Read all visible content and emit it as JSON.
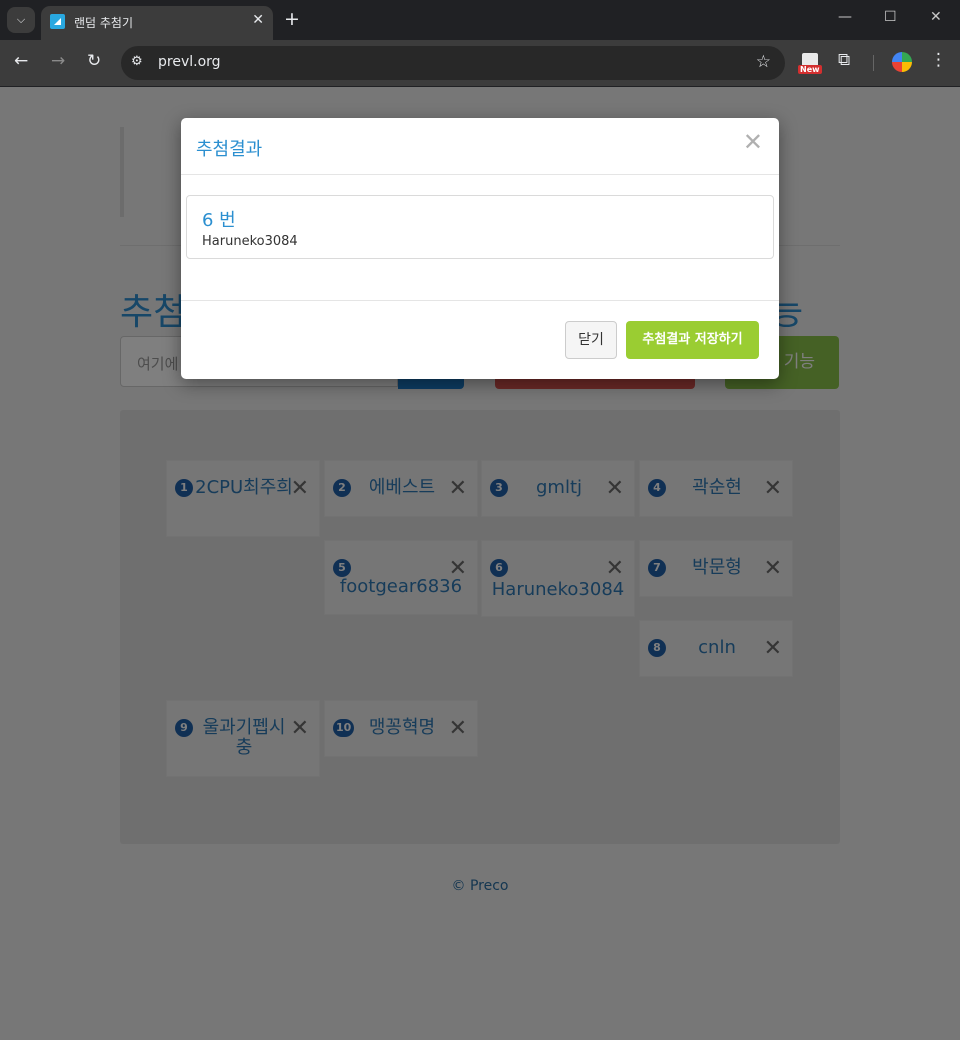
{
  "browser": {
    "tab_title": "랜덤 추첨기",
    "url": "prevl.org",
    "extension_badge": "New"
  },
  "page": {
    "heading_start": "추첨",
    "heading_end": "능",
    "input_placeholder_visible": "여기에",
    "green_button_label_visible": "기능",
    "participants": [
      {
        "number": "1",
        "name": "2CPU최주희"
      },
      {
        "number": "2",
        "name": "에베스트"
      },
      {
        "number": "3",
        "name": "gmltj"
      },
      {
        "number": "4",
        "name": "곽순현"
      },
      {
        "number": "5",
        "name": "footgear6836"
      },
      {
        "number": "6",
        "name": "Haruneko3084"
      },
      {
        "number": "7",
        "name": "박문형"
      },
      {
        "number": "8",
        "name": "cnln"
      },
      {
        "number": "9",
        "name": "울과기펩시충"
      },
      {
        "number": "10",
        "name": "맹꽁혁명"
      }
    ],
    "footer": "© Preco"
  },
  "modal": {
    "title": "추첨결과",
    "result_number": "6 번",
    "result_name": "Haruneko3084",
    "close_label": "닫기",
    "save_label": "추첨결과 저장하기"
  },
  "icons": {
    "tab_search": "chevron-down-icon",
    "close": "close-icon",
    "star": "bookmark-star-icon",
    "extensions": "puzzle-icon",
    "menu": "kebab-menu-icon"
  },
  "colors": {
    "accent_blue": "#2b8fd0",
    "badge_blue": "#2160a8",
    "save_green": "#9acd32",
    "danger_red": "#d9534f"
  }
}
